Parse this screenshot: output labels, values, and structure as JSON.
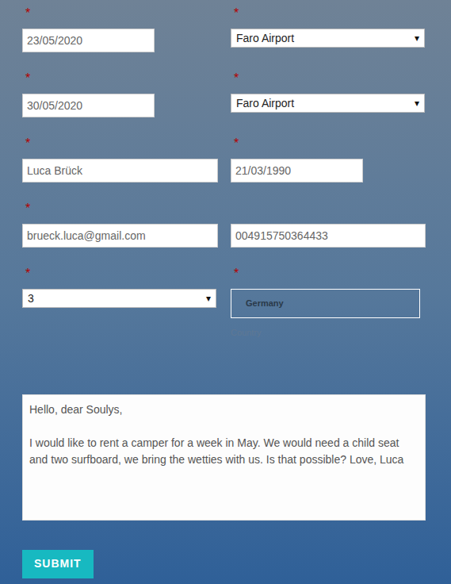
{
  "form": {
    "rows": [
      {
        "fields": [
          {
            "kind": "date",
            "required": true,
            "marker": "*",
            "value": "23/05/2020"
          },
          {
            "kind": "select",
            "required": true,
            "marker": "*",
            "value": "Faro Airport",
            "arrow": "▾"
          }
        ]
      },
      {
        "fields": [
          {
            "kind": "date",
            "required": true,
            "marker": "*",
            "value": "30/05/2020"
          },
          {
            "kind": "select",
            "required": true,
            "marker": "*",
            "value": "Faro Airport",
            "arrow": "▾"
          }
        ]
      },
      {
        "fields": [
          {
            "kind": "name",
            "required": true,
            "marker": "*",
            "value": "Luca Brück"
          },
          {
            "kind": "date",
            "required": true,
            "marker": "*",
            "value": "21/03/1990"
          }
        ]
      },
      {
        "fields": [
          {
            "kind": "email",
            "required": true,
            "marker": "*",
            "value": "brueck.luca@gmail.com"
          },
          {
            "kind": "phone",
            "required": false,
            "value": "004915750364433"
          }
        ]
      },
      {
        "fields": [
          {
            "kind": "select",
            "required": true,
            "marker": "*",
            "value": "3",
            "arrow": "▾"
          },
          {
            "kind": "country",
            "required": true,
            "marker": "*",
            "value": "Germany",
            "label": "Country"
          }
        ]
      }
    ],
    "message": "Hello, dear Soulys,\n\nI would like to rent a camper for a week in May. We would need a child seat and two surfboard, we bring the wetties with us. Is that possible? Love, Luca",
    "submit": "SUBMIT"
  }
}
